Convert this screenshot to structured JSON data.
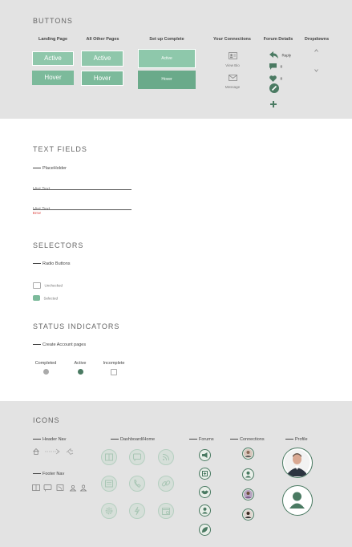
{
  "colors": {
    "band_grey": "#e3e3e3",
    "accent": "#7cba9b",
    "accent_dark": "#4a7a62",
    "error": "#d9302c"
  },
  "buttons": {
    "title": "BUTTONS",
    "col_landing": "Landing Page",
    "col_other": "All Other Pages",
    "col_setup": "Set up Complete",
    "col_connections": "Your Connections",
    "col_forum": "Forum Details",
    "col_dropdowns": "Dropdowns",
    "active": "Active",
    "hover": "Hover",
    "view_bio": "View Bio",
    "message": "Message",
    "reply": "Reply",
    "comment_count": "8",
    "like_count": "8",
    "icons": [
      "profile-card-icon",
      "envelope-icon",
      "reply-arrow-icon",
      "comment-icon",
      "heart-icon",
      "edit-icon",
      "plus-icon",
      "chevron-up-icon",
      "chevron-down-icon"
    ]
  },
  "text_fields": {
    "title": "TEXT FIELDS",
    "placeholder_label": "PlaceHolder",
    "hint1": "Hint Text",
    "hint2": "Hint Text",
    "error": "Error"
  },
  "selectors": {
    "title": "SELECTORS",
    "radio_label": "Radio Buttons",
    "unchecked": "Unchecked",
    "selected": "Selected"
  },
  "status": {
    "title": "STATUS INDICATORS",
    "sub": "Create Account pages",
    "completed": "Completed",
    "active": "Active",
    "incomplete": "Incomplete"
  },
  "icons_section": {
    "title": "ICONS",
    "header_nav": "Header Nav",
    "footer_nav": "Footer Nav",
    "dashboard": "Dashboard/Home",
    "forums": "Forums",
    "connections": "Connections",
    "profile": "Profile",
    "icon_names": [
      "home-icon",
      "arrows-icon",
      "share-icon",
      "book-icon",
      "chat-icon",
      "rss-icon",
      "newspaper-icon",
      "phone-icon",
      "link-icon",
      "gear-icon",
      "lightning-icon",
      "calendar-icon",
      "megaphone-icon",
      "plus-box-icon",
      "handshake-icon",
      "person-icon",
      "leaf-icon",
      "avatar-icon"
    ]
  }
}
